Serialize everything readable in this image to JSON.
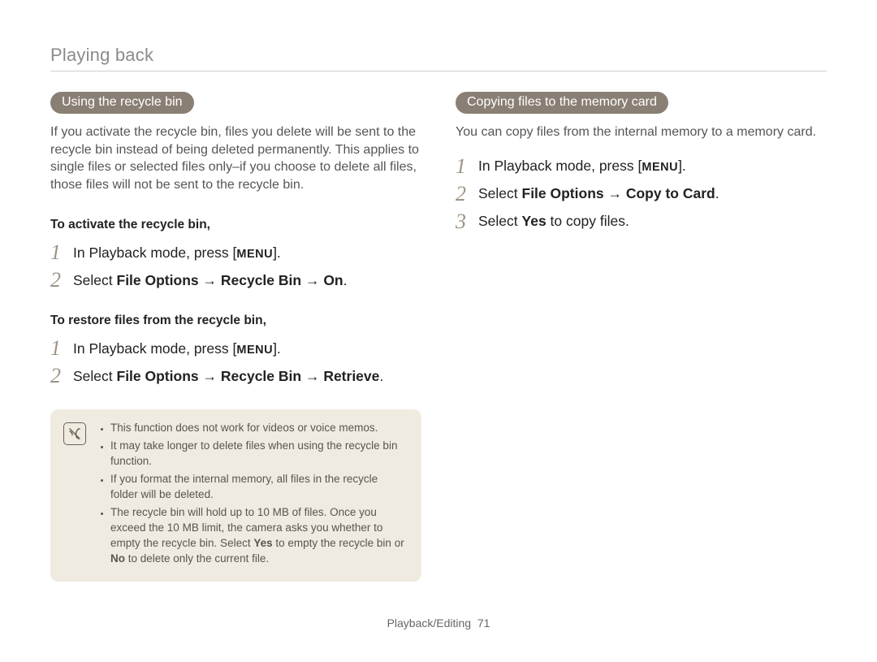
{
  "header": "Playing back",
  "left": {
    "pill": "Using the recycle bin",
    "intro": "If you activate the recycle bin, files you delete will be sent to the recycle bin instead of being deleted permanently. This applies to single files or selected files only–if you choose to delete all files, those files will not be sent to the recycle bin.",
    "sub1": "To activate the recycle bin,",
    "s1": {
      "n1": "1",
      "t1a": "In Playback mode, press [",
      "t1menu": "MENU",
      "t1b": "].",
      "n2": "2",
      "t2a": "Select ",
      "t2b": "File Options",
      "t2arrow1": " → ",
      "t2c": "Recycle Bin",
      "t2arrow2": " → ",
      "t2d": "On",
      "t2e": "."
    },
    "sub2": "To restore files from the recycle bin,",
    "s2": {
      "n1": "1",
      "t1a": "In Playback mode, press [",
      "t1menu": "MENU",
      "t1b": "].",
      "n2": "2",
      "t2a": "Select ",
      "t2b": "File Options",
      "t2arrow1": " → ",
      "t2c": "Recycle Bin",
      "t2arrow2": " → ",
      "t2d": "Retrieve",
      "t2e": "."
    },
    "notes": {
      "i0": "This function does not work for videos or voice memos.",
      "i1": "It may take longer to delete files when using the recycle bin function.",
      "i2": "If you format the internal memory, all files in the recycle folder will be deleted.",
      "i3a": "The recycle bin will hold up to 10 MB of files. Once you exceed the 10 MB limit, the camera asks you whether to empty the recycle bin. Select ",
      "i3yes": "Yes",
      "i3b": " to empty the recycle bin or ",
      "i3no": "No",
      "i3c": " to delete only the current file."
    }
  },
  "right": {
    "pill": "Copying files to the memory card",
    "intro": "You can copy files from the internal memory to a memory card.",
    "s": {
      "n1": "1",
      "t1a": "In Playback mode, press [",
      "t1menu": "MENU",
      "t1b": "].",
      "n2": "2",
      "t2a": "Select ",
      "t2b": "File Options",
      "t2arrow": " → ",
      "t2c": "Copy to Card",
      "t2d": ".",
      "n3": "3",
      "t3a": "Select ",
      "t3b": "Yes",
      "t3c": " to copy files."
    }
  },
  "footer": {
    "section": "Playback/Editing",
    "page": "71"
  }
}
